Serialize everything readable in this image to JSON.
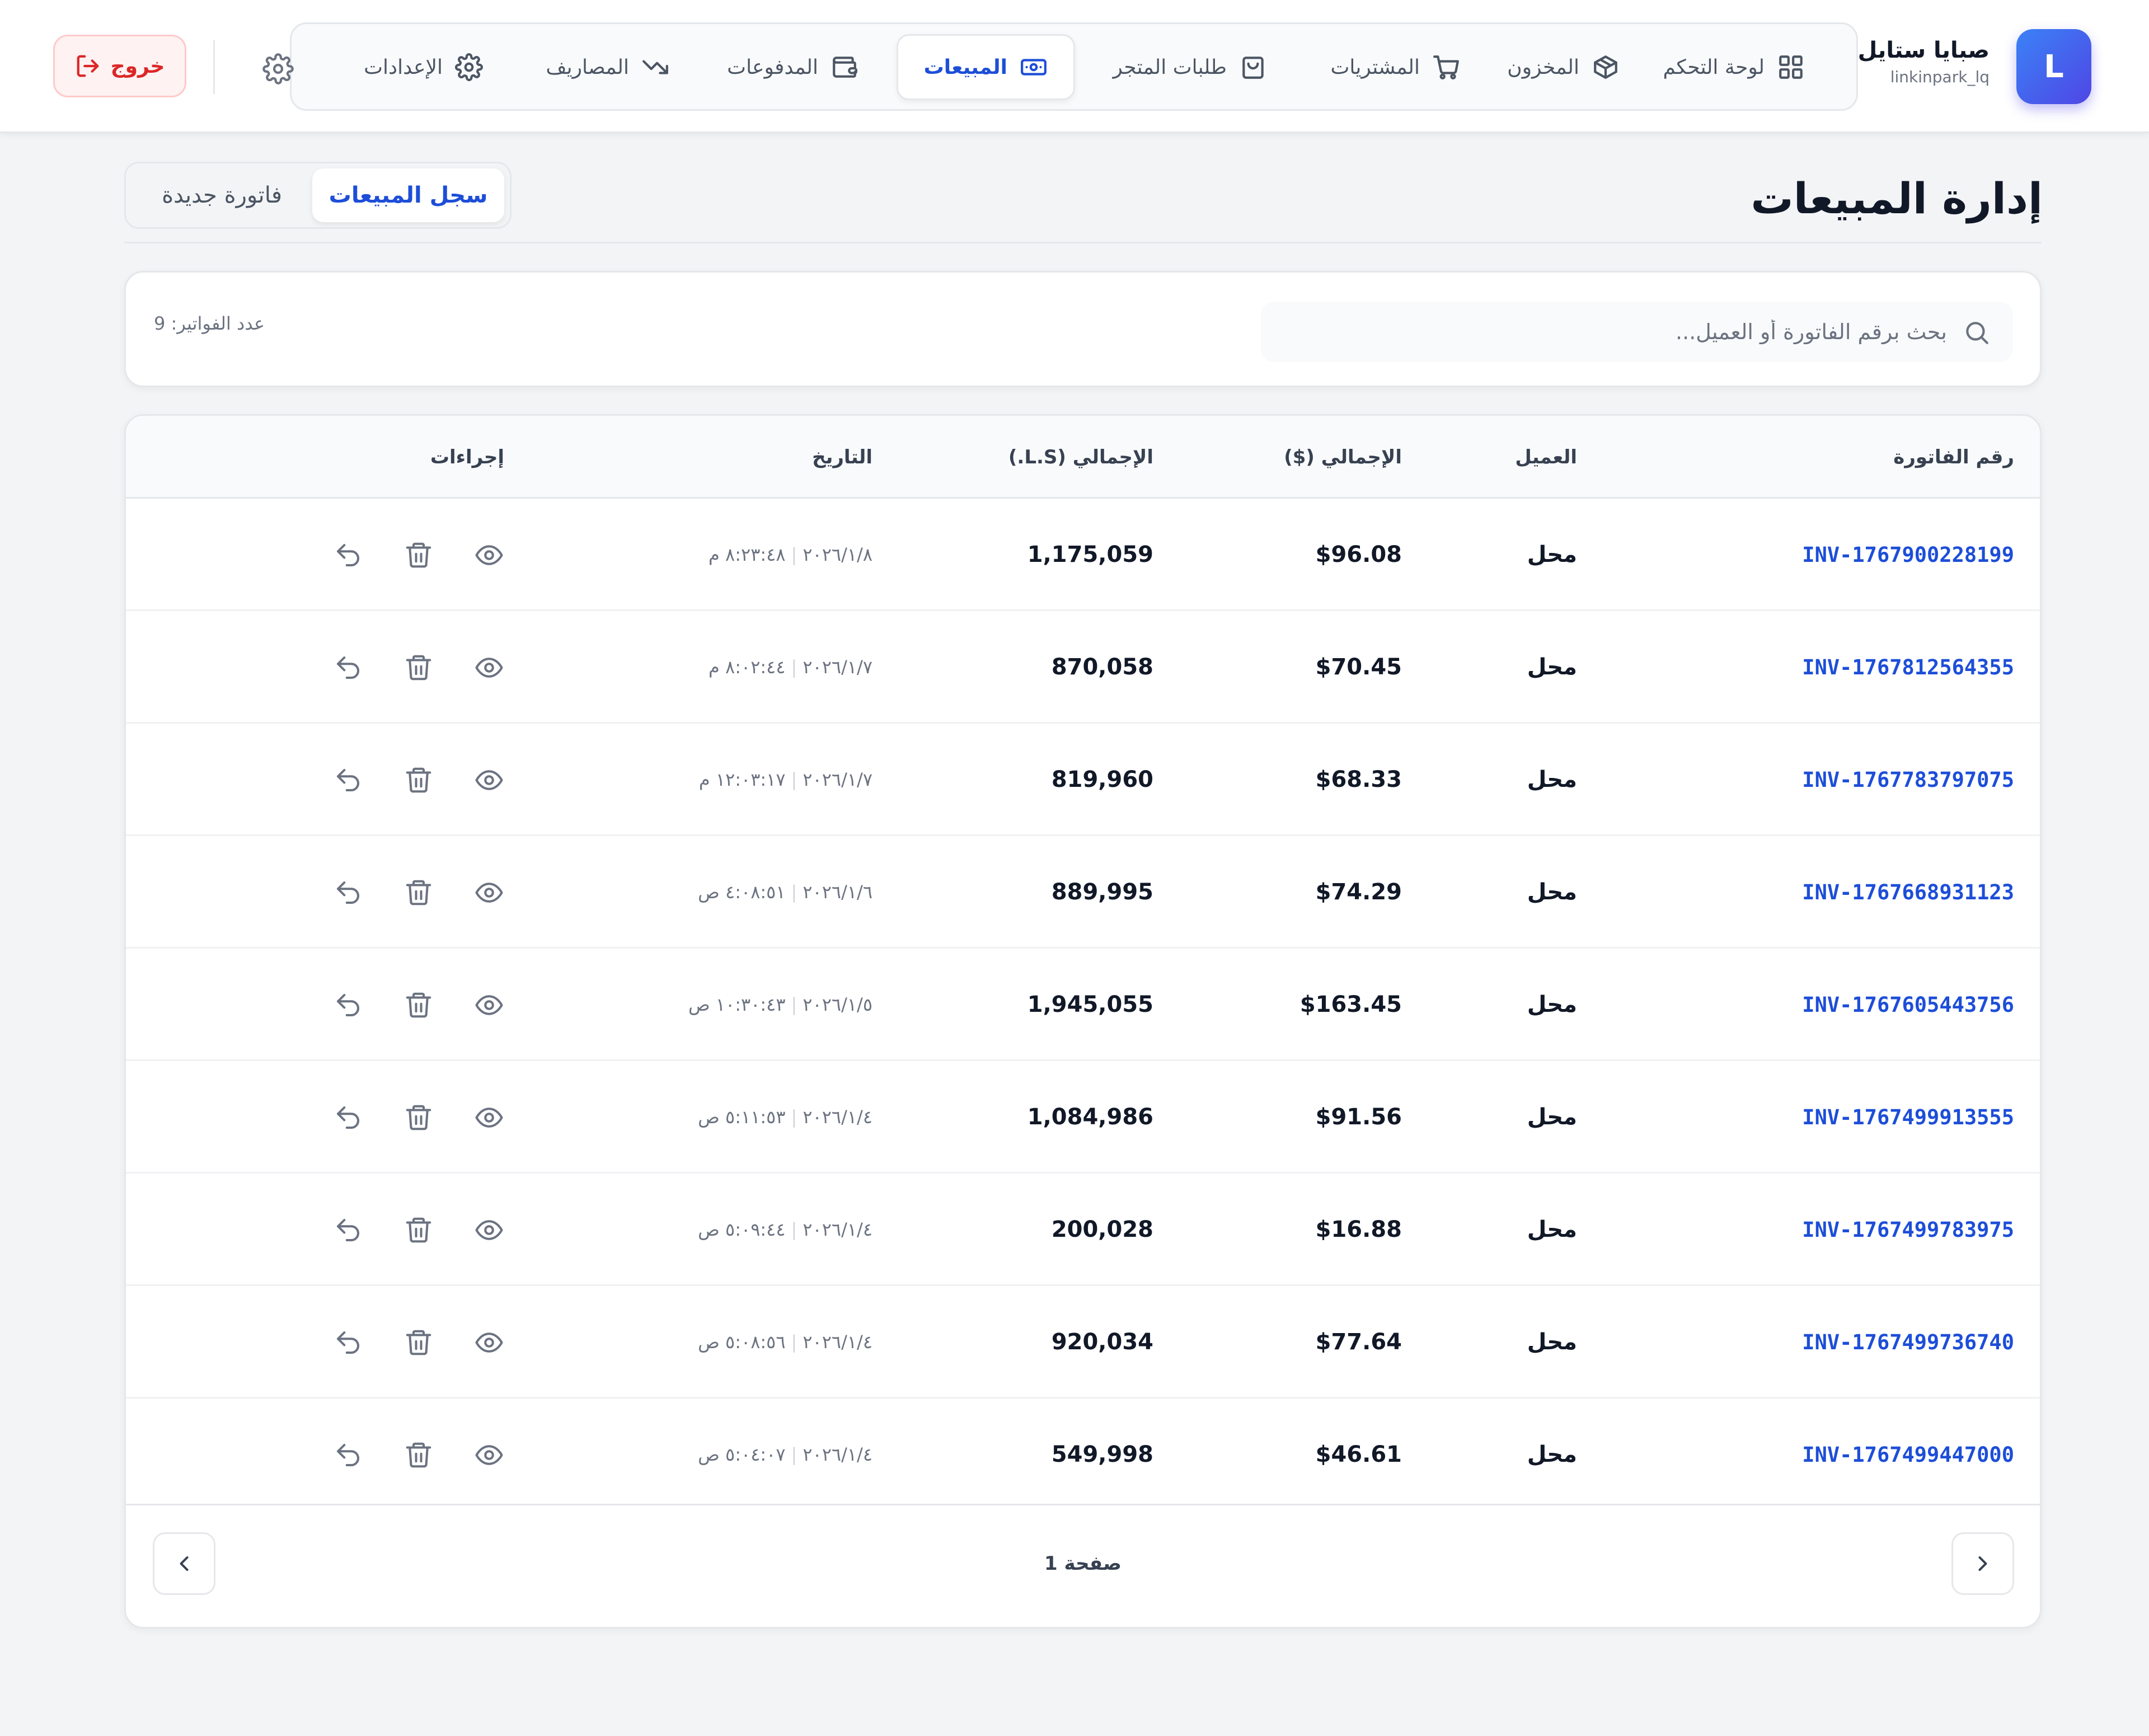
{
  "brand": {
    "avatar_letter": "L",
    "name": "صبايا ستايل",
    "username": "linkinpark_lq"
  },
  "nav": {
    "items": [
      {
        "label": "لوحة التحكم",
        "icon": "dashboard-grid-icon"
      },
      {
        "label": "المخزون",
        "icon": "box-icon"
      },
      {
        "label": "المشتريات",
        "icon": "cart-icon"
      },
      {
        "label": "طلبات المتجر",
        "icon": "shopping-bag-icon"
      },
      {
        "label": "المبيعات",
        "icon": "banknote-icon",
        "active": true
      },
      {
        "label": "المدفوعات",
        "icon": "wallet-icon"
      },
      {
        "label": "المصاريف",
        "icon": "trending-down-icon"
      },
      {
        "label": "الإعدادات",
        "icon": "gear-icon"
      }
    ]
  },
  "header": {
    "logout_label": "خروج"
  },
  "page": {
    "title": "إدارة المبيعات",
    "tabs": [
      {
        "label": "سجل المبيعات",
        "active": true
      },
      {
        "label": "فاتورة جديدة",
        "active": false
      }
    ]
  },
  "search": {
    "placeholder": "بحث برقم الفاتورة أو العميل...",
    "value": "",
    "count_label": "عدد الفواتير: 9"
  },
  "table": {
    "columns": [
      "رقم الفاتورة",
      "العميل",
      "الإجمالي ($)",
      "الإجمالي (L.S.)",
      "التاريخ",
      "إجراءات"
    ],
    "rows": [
      {
        "invoice": "INV-1767900228199",
        "customer": "محل",
        "total_usd": "$96.08",
        "total_ls": "1,175,059",
        "date": "٢٠٢٦/١/٨",
        "time": "٨:٢٣:٤٨ م"
      },
      {
        "invoice": "INV-1767812564355",
        "customer": "محل",
        "total_usd": "$70.45",
        "total_ls": "870,058",
        "date": "٢٠٢٦/١/٧",
        "time": "٨:٠٢:٤٤ م"
      },
      {
        "invoice": "INV-1767783797075",
        "customer": "محل",
        "total_usd": "$68.33",
        "total_ls": "819,960",
        "date": "٢٠٢٦/١/٧",
        "time": "١٢:٠٣:١٧ م"
      },
      {
        "invoice": "INV-1767668931123",
        "customer": "محل",
        "total_usd": "$74.29",
        "total_ls": "889,995",
        "date": "٢٠٢٦/١/٦",
        "time": "٤:٠٨:٥١ ص"
      },
      {
        "invoice": "INV-1767605443756",
        "customer": "محل",
        "total_usd": "$163.45",
        "total_ls": "1,945,055",
        "date": "٢٠٢٦/١/٥",
        "time": "١٠:٣٠:٤٣ ص"
      },
      {
        "invoice": "INV-1767499913555",
        "customer": "محل",
        "total_usd": "$91.56",
        "total_ls": "1,084,986",
        "date": "٢٠٢٦/١/٤",
        "time": "٥:١١:٥٣ ص"
      },
      {
        "invoice": "INV-1767499783975",
        "customer": "محل",
        "total_usd": "$16.88",
        "total_ls": "200,028",
        "date": "٢٠٢٦/١/٤",
        "time": "٥:٠٩:٤٤ ص"
      },
      {
        "invoice": "INV-1767499736740",
        "customer": "محل",
        "total_usd": "$77.64",
        "total_ls": "920,034",
        "date": "٢٠٢٦/١/٤",
        "time": "٥:٠٨:٥٦ ص"
      },
      {
        "invoice": "INV-1767499447000",
        "customer": "محل",
        "total_usd": "$46.61",
        "total_ls": "549,998",
        "date": "٢٠٢٦/١/٤",
        "time": "٥:٠٤:٠٧ ص"
      }
    ]
  },
  "pagination": {
    "label": "صفحة 1"
  },
  "colors": {
    "primary": "#1d4ed8",
    "danger": "#dc2626",
    "muted": "#6b7280",
    "border": "#e5e7eb"
  }
}
